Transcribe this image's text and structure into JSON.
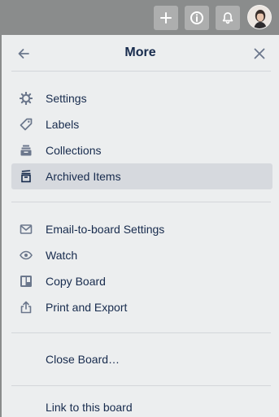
{
  "panel": {
    "title": "More",
    "back_icon": "arrow-left-icon",
    "close_icon": "close-icon"
  },
  "topbar": {
    "buttons": [
      "plus-icon",
      "info-icon",
      "bell-icon"
    ],
    "avatar": "user-avatar"
  },
  "menu": {
    "group1": [
      {
        "label": "Settings",
        "icon": "gear-icon"
      },
      {
        "label": "Labels",
        "icon": "tag-icon"
      },
      {
        "label": "Collections",
        "icon": "collections-icon"
      },
      {
        "label": "Archived Items",
        "icon": "archive-icon",
        "active": true
      }
    ],
    "group2": [
      {
        "label": "Email-to-board Settings",
        "icon": "envelope-icon"
      },
      {
        "label": "Watch",
        "icon": "eye-icon"
      },
      {
        "label": "Copy Board",
        "icon": "copy-board-icon"
      },
      {
        "label": "Print and Export",
        "icon": "share-icon"
      }
    ],
    "close_board": "Close Board…",
    "link_board": "Link to this board"
  },
  "colors": {
    "text": "#172b4d",
    "icon": "#6b778c",
    "active_bg": "#d6d9de",
    "panel_bg": "#eceeef"
  }
}
